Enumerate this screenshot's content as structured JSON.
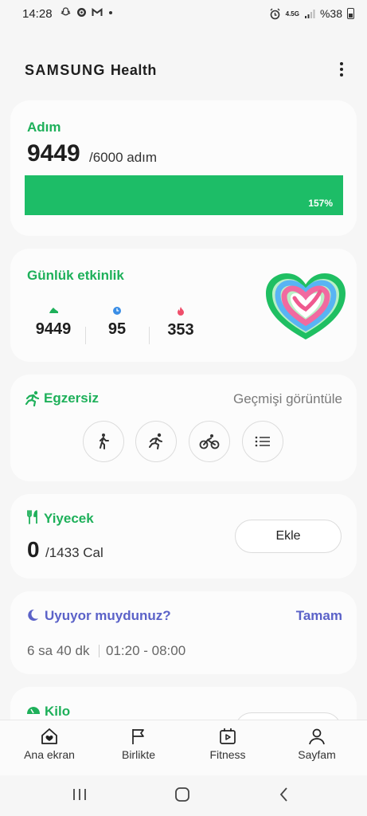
{
  "status_bar": {
    "time": "14:28",
    "network": "4.5G",
    "battery": "%38"
  },
  "app": {
    "title_brand": "SAMSUNG",
    "title_product": "Health"
  },
  "steps_card": {
    "title": "Adım",
    "count": "9449",
    "goal": "/6000 adım",
    "progress_label": "157%",
    "progress_fraction": 1.0,
    "accent": "#1dbd67"
  },
  "activity_card": {
    "title": "Günlük etkinlik",
    "stats": [
      {
        "icon": "shoe-icon",
        "value": "9449"
      },
      {
        "icon": "clock-icon",
        "value": "95"
      },
      {
        "icon": "flame-icon",
        "value": "353"
      }
    ]
  },
  "exercise_card": {
    "title": "Egzersiz",
    "history_link": "Geçmişi görüntüle",
    "quick_buttons": [
      "walk-icon",
      "run-icon",
      "cycle-icon",
      "list-icon"
    ]
  },
  "food_card": {
    "title": "Yiyecek",
    "value": "0",
    "goal": "/1433 Cal",
    "add_label": "Ekle"
  },
  "sleep_card": {
    "title": "Uyuyor muydunuz?",
    "action": "Tamam",
    "duration": "6 sa 40 dk",
    "range": "01:20 - 08:00",
    "accent": "#5b62c8"
  },
  "weight_card": {
    "title": "Kilo"
  },
  "bottom_nav": {
    "items": [
      {
        "label": "Ana ekran",
        "icon": "home-icon"
      },
      {
        "label": "Birlikte",
        "icon": "flag-icon"
      },
      {
        "label": "Fitness",
        "icon": "video-icon"
      },
      {
        "label": "Sayfam",
        "icon": "person-icon"
      }
    ]
  }
}
